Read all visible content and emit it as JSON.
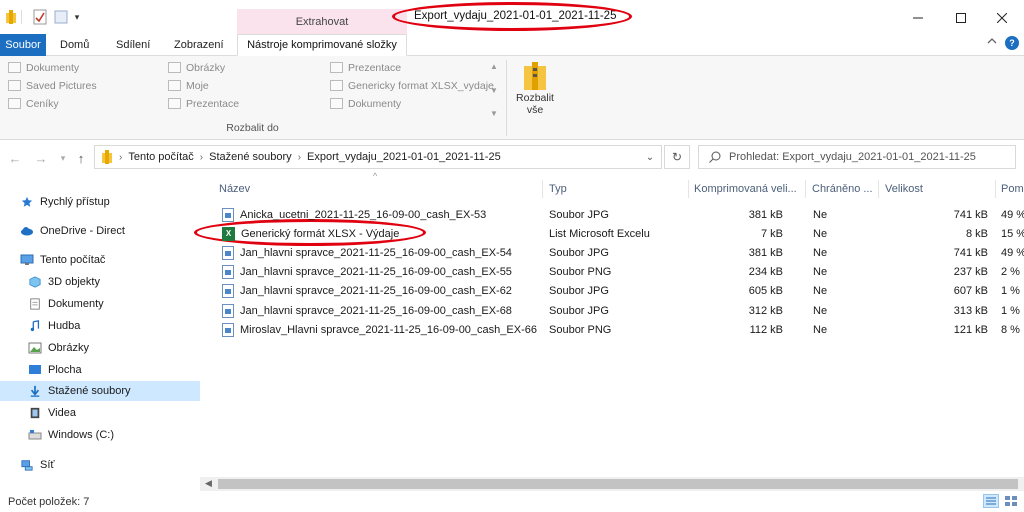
{
  "window": {
    "title": "Export_vydaju_2021-01-01_2021-11-25",
    "context_tab": "Extrahovat"
  },
  "tabs": {
    "file": "Soubor",
    "items": [
      "Domů",
      "Sdílení",
      "Zobrazení"
    ],
    "tools": "Nástroje komprimované složky"
  },
  "ribbon": {
    "gallery_col1": [
      "Dokumenty",
      "Saved Pictures",
      "Ceníky"
    ],
    "gallery_col2": [
      "Obrázky",
      "Moje",
      "Prezentace"
    ],
    "gallery_col3": [
      "Prezentace",
      "Genericky format XLSX_vydaje",
      "Dokumenty"
    ],
    "group_label": "Rozbalit do",
    "extract_all": [
      "Rozbalit",
      "vše"
    ]
  },
  "address": {
    "crumbs": [
      "Tento počítač",
      "Stažené soubory",
      "Export_vydaju_2021-01-01_2021-11-25"
    ],
    "search_placeholder": "Prohledat: Export_vydaju_2021-01-01_2021-11-25"
  },
  "sidebar": [
    {
      "label": "Rychlý přístup",
      "icon": "star-icon"
    },
    {
      "label": "OneDrive - Direct",
      "icon": "cloud-icon"
    },
    {
      "label": "Tento počítač",
      "icon": "computer-icon"
    },
    {
      "label": "3D objekty",
      "icon": "cube-icon"
    },
    {
      "label": "Dokumenty",
      "icon": "document-icon"
    },
    {
      "label": "Hudba",
      "icon": "music-icon"
    },
    {
      "label": "Obrázky",
      "icon": "pictures-icon"
    },
    {
      "label": "Plocha",
      "icon": "desktop-icon"
    },
    {
      "label": "Stažené soubory",
      "icon": "download-icon",
      "selected": true
    },
    {
      "label": "Videa",
      "icon": "video-icon"
    },
    {
      "label": "Windows (C:)",
      "icon": "drive-icon"
    },
    {
      "label": "Síť",
      "icon": "network-icon"
    }
  ],
  "columns": [
    "Název",
    "Typ",
    "Komprimovaná veli...",
    "Chráněno ...",
    "Velikost",
    "Pom"
  ],
  "files": [
    {
      "name": "Anicka_ucetni_2021-11-25_16-09-00_cash_EX-53",
      "type": "Soubor JPG",
      "compressed": "381 kB",
      "protected": "Ne",
      "size": "741 kB",
      "ratio": "49 %",
      "icon": "image-file-icon"
    },
    {
      "name": "Generický formát XLSX - Výdaje",
      "type": "List Microsoft Excelu",
      "compressed": "7 kB",
      "protected": "Ne",
      "size": "8 kB",
      "ratio": "15 %",
      "icon": "excel-file-icon"
    },
    {
      "name": "Jan_hlavni spravce_2021-11-25_16-09-00_cash_EX-54",
      "type": "Soubor JPG",
      "compressed": "381 kB",
      "protected": "Ne",
      "size": "741 kB",
      "ratio": "49 %",
      "icon": "image-file-icon"
    },
    {
      "name": "Jan_hlavni spravce_2021-11-25_16-09-00_cash_EX-55",
      "type": "Soubor PNG",
      "compressed": "234 kB",
      "protected": "Ne",
      "size": "237 kB",
      "ratio": "2 %",
      "icon": "image-file-icon"
    },
    {
      "name": "Jan_hlavni spravce_2021-11-25_16-09-00_cash_EX-62",
      "type": "Soubor JPG",
      "compressed": "605 kB",
      "protected": "Ne",
      "size": "607 kB",
      "ratio": "1 %",
      "icon": "image-file-icon"
    },
    {
      "name": "Jan_hlavni spravce_2021-11-25_16-09-00_cash_EX-68",
      "type": "Soubor JPG",
      "compressed": "312 kB",
      "protected": "Ne",
      "size": "313 kB",
      "ratio": "1 %",
      "icon": "image-file-icon"
    },
    {
      "name": "Miroslav_Hlavni spravce_2021-11-25_16-09-00_cash_EX-66",
      "type": "Soubor PNG",
      "compressed": "112 kB",
      "protected": "Ne",
      "size": "121 kB",
      "ratio": "8 %",
      "icon": "image-file-icon"
    }
  ],
  "status": {
    "count": "Počet položek: 7"
  },
  "colors": {
    "accent": "#1c6fc0",
    "context_tab": "#fbe3ee",
    "selection": "#cde8ff",
    "annotation": "#e0000f"
  }
}
